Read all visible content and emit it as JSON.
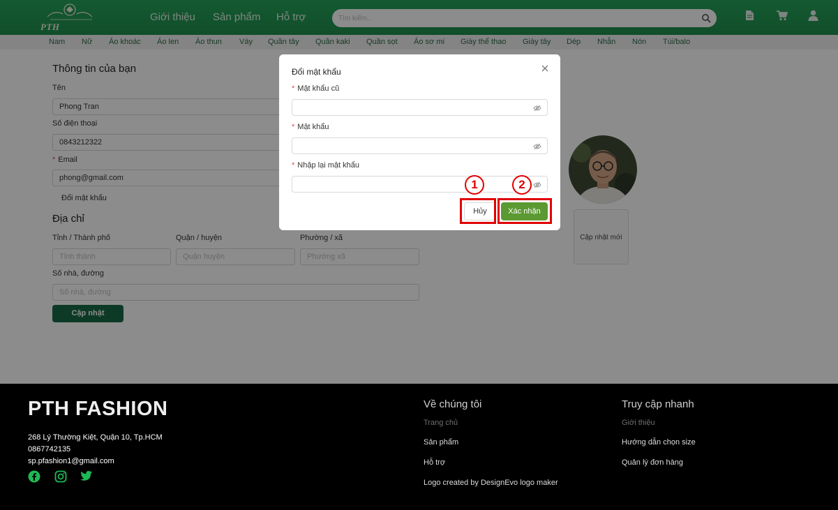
{
  "header": {
    "logo_text": "PTH FASHION",
    "nav": [
      "Giới thiệu",
      "Sản phẩm",
      "Hỗ trợ"
    ],
    "search_placeholder": "Tìm kiếm...",
    "icons": [
      "document-icon",
      "cart-icon",
      "user-icon"
    ]
  },
  "categories": [
    "Nam",
    "Nữ",
    "Áo khoác",
    "Áo len",
    "Áo thun",
    "Váy",
    "Quần tây",
    "Quần kaki",
    "Quần sọt",
    "Áo sơ mi",
    "Giày thể thao",
    "Giày tây",
    "Dép",
    "Nhẫn",
    "Nón",
    "Túi/balo"
  ],
  "profile": {
    "title": "Thông tin của bạn",
    "name_label": "Tên",
    "name_value": "Phong Tran",
    "phone_label": "Số điện thoại",
    "phone_value": "0843212322",
    "email_label": "Email",
    "email_value": "phong@gmail.com",
    "change_password_link": "Đổi mật khẩu",
    "upload_label": "Cập nhật mới"
  },
  "address": {
    "title": "Địa chỉ",
    "city_label": "Tỉnh / Thành phố",
    "city_placeholder": "Tỉnh thành",
    "district_label": "Quận / huyện",
    "district_placeholder": "Quận huyện",
    "ward_label": "Phường / xã",
    "ward_placeholder": "Phường xã",
    "street_label": "Số nhà, đường",
    "street_placeholder": "Số nhà, đường",
    "update_button": "Cập nhật"
  },
  "modal": {
    "title": "Đổi mật khẩu",
    "old_password_label": "Mật khẩu cũ",
    "new_password_label": "Mật khẩu",
    "confirm_password_label": "Nhập lại mật khẩu",
    "cancel_button": "Hủy",
    "confirm_button": "Xác nhận"
  },
  "annotations": {
    "marker_1": "1",
    "marker_2": "2",
    "highlight_color": "#e00000"
  },
  "footer": {
    "brand": "PTH FASHION",
    "address": "268 Lý Thường Kiệt, Quận 10, Tp.HCM",
    "phone": "0867742135",
    "email": "sp.pfashion1@gmail.com",
    "about_title": "Về chúng tôi",
    "about_links": [
      "Trang chủ",
      "Sản phẩm",
      "Hỗ trợ",
      "Logo created by DesignEvo logo maker"
    ],
    "quick_title": "Truy cập nhanh",
    "quick_links": [
      "Giới thiệu",
      "Hướng dẫn chọn size",
      "Quản lý đơn hàng"
    ],
    "social_icons": [
      "facebook-icon",
      "instagram-icon",
      "twitter-icon"
    ]
  },
  "colors": {
    "header_green": "#25a35a",
    "primary_dark_green": "#166a47",
    "confirm_green": "#5b9a32",
    "social_green": "#1db954"
  }
}
